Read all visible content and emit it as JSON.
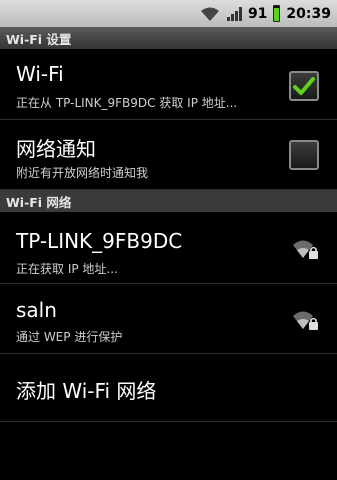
{
  "status_bar": {
    "icons": [
      "wifi-icon",
      "signal-icon",
      "battery-icon"
    ],
    "battery_level": "91",
    "time": "20:39",
    "battery_color": "#57d31b"
  },
  "header": {
    "title": "Wi-Fi 设置"
  },
  "wifi_toggle": {
    "title": "Wi-Fi",
    "summary": "正在从 TP-LINK_9FB9DC 获取 IP 地址...",
    "checked": true,
    "check_color": "#5fd01b"
  },
  "network_notification": {
    "title": "网络通知",
    "summary": "附近有开放网络时通知我",
    "checked": false
  },
  "networks_section": {
    "title": "Wi-Fi 网络"
  },
  "networks": [
    {
      "ssid": "TP-LINK_9FB9DC",
      "status": "正在获取 IP 地址...",
      "icon": "wifi-lock-icon"
    },
    {
      "ssid": "saln",
      "status": "通过 WEP 进行保护",
      "icon": "wifi-lock-icon"
    }
  ],
  "add_network": {
    "label": "添加 Wi-Fi 网络"
  }
}
